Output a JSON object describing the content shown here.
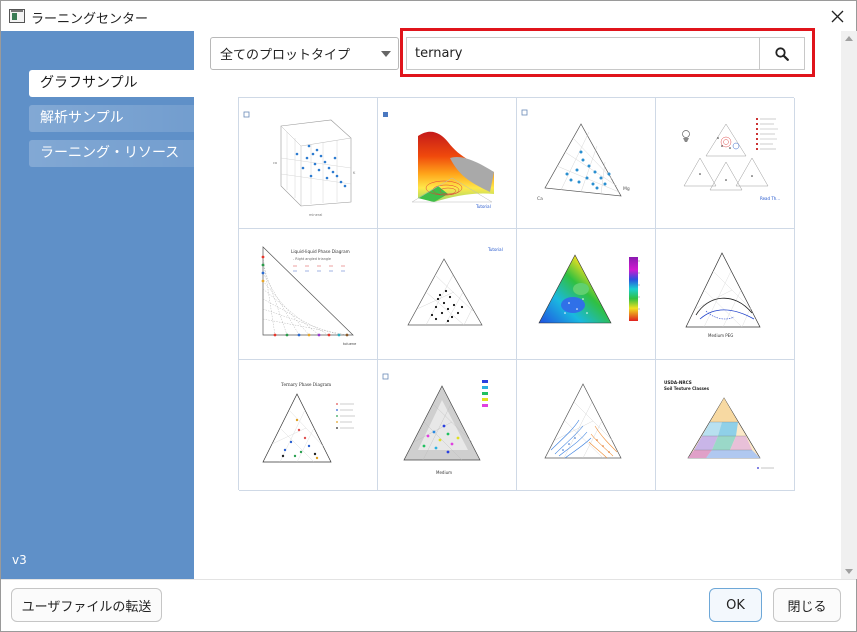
{
  "window": {
    "title": "ラーニングセンター"
  },
  "sidebar": {
    "items": [
      {
        "label": "グラフサンプル",
        "active": true
      },
      {
        "label": "解析サンプル",
        "active": false
      },
      {
        "label": "ラーニング・リソース",
        "active": false
      }
    ],
    "version": "v3"
  },
  "toolbar": {
    "plot_type_selected": "全てのプロットタイプ",
    "search_value": "ternary"
  },
  "gallery": {
    "thumbnails": [
      {
        "icon": "3d-ternary-scatter-thumbnail"
      },
      {
        "icon": "ternary-surface-thumbnail",
        "link": "Tutorial"
      },
      {
        "icon": "ternary-scatter-ca-mg-thumbnail",
        "axis_labels": [
          "Ca",
          "Mg"
        ]
      },
      {
        "icon": "multi-ternary-panels-thumbnail",
        "link": "Read Th..."
      },
      {
        "icon": "liquid-phase-diagram-thumbnail",
        "title": "Liquid-liquid Phase Diagram",
        "subtitle": "- Right angled triangle",
        "xlabel": "toluene"
      },
      {
        "icon": "ternary-scatter-tutorial-thumbnail",
        "link": "Tutorial"
      },
      {
        "icon": "ternary-contour-colormap-thumbnail"
      },
      {
        "icon": "ternary-line-thumbnail",
        "xlabel": "Medium PEG"
      },
      {
        "icon": "ternary-phase-diagram-thumbnail",
        "title": "Ternary Phase Diagram"
      },
      {
        "icon": "ternary-colored-groups-thumbnail",
        "xlabel": "Medium"
      },
      {
        "icon": "ternary-blue-orange-thumbnail"
      },
      {
        "icon": "soil-texture-classes-thumbnail",
        "title": "USDA-NRCS",
        "subtitle": "Soil Texture Classes"
      }
    ]
  },
  "footer": {
    "transfer_label": "ユーザファイルの転送",
    "ok_label": "OK",
    "close_label": "閉じる"
  },
  "colors": {
    "sidebar": "#5f90c8",
    "highlight": "#e0141b",
    "grid_border": "#cfd9e6"
  }
}
